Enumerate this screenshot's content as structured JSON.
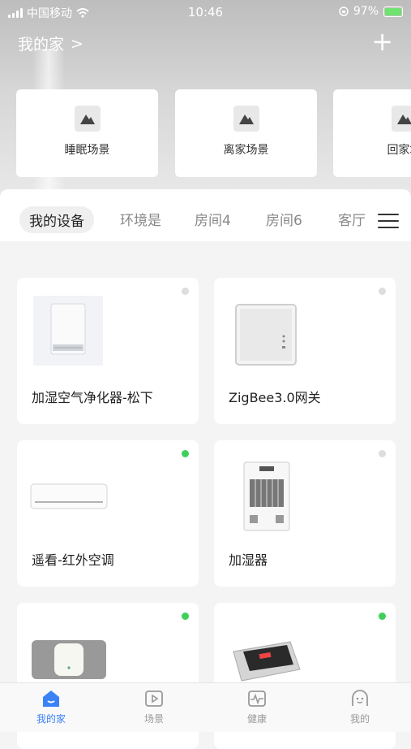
{
  "status_bar": {
    "carrier": "中国移动",
    "time": "10:46",
    "battery": "97%"
  },
  "header": {
    "title": "我的家",
    "chevron": ">",
    "add": "+"
  },
  "scenes": [
    {
      "label": "睡眠场景",
      "icon": "mountain-icon"
    },
    {
      "label": "离家场景",
      "icon": "mountain-icon"
    },
    {
      "label": "回家场",
      "icon": "mountain-icon"
    }
  ],
  "tabs": [
    {
      "label": "我的设备",
      "active": true
    },
    {
      "label": "环境是",
      "active": false
    },
    {
      "label": "房间4",
      "active": false
    },
    {
      "label": "房间6",
      "active": false
    },
    {
      "label": "客厅",
      "active": false
    }
  ],
  "devices": [
    {
      "name": "加湿空气净化器-松下",
      "status_color": "#dddddd"
    },
    {
      "name": "ZigBee3.0网关",
      "status_color": "#dddddd"
    },
    {
      "name": "遥看-红外空调",
      "status_color": "#3ecf5b"
    },
    {
      "name": "加湿器",
      "status_color": "#dddddd"
    },
    {
      "name": "",
      "status_color": "#3ecf5b"
    },
    {
      "name": "",
      "status_color": "#3ecf5b"
    }
  ],
  "tabbar": [
    {
      "label": "我的家",
      "active": true,
      "icon": "home-icon"
    },
    {
      "label": "场景",
      "active": false,
      "icon": "play-icon"
    },
    {
      "label": "健康",
      "active": false,
      "icon": "pulse-icon"
    },
    {
      "label": "我的",
      "active": false,
      "icon": "face-icon"
    }
  ],
  "colors": {
    "accent": "#3b82f6",
    "online": "#3ecf5b",
    "offline": "#dddddd"
  }
}
